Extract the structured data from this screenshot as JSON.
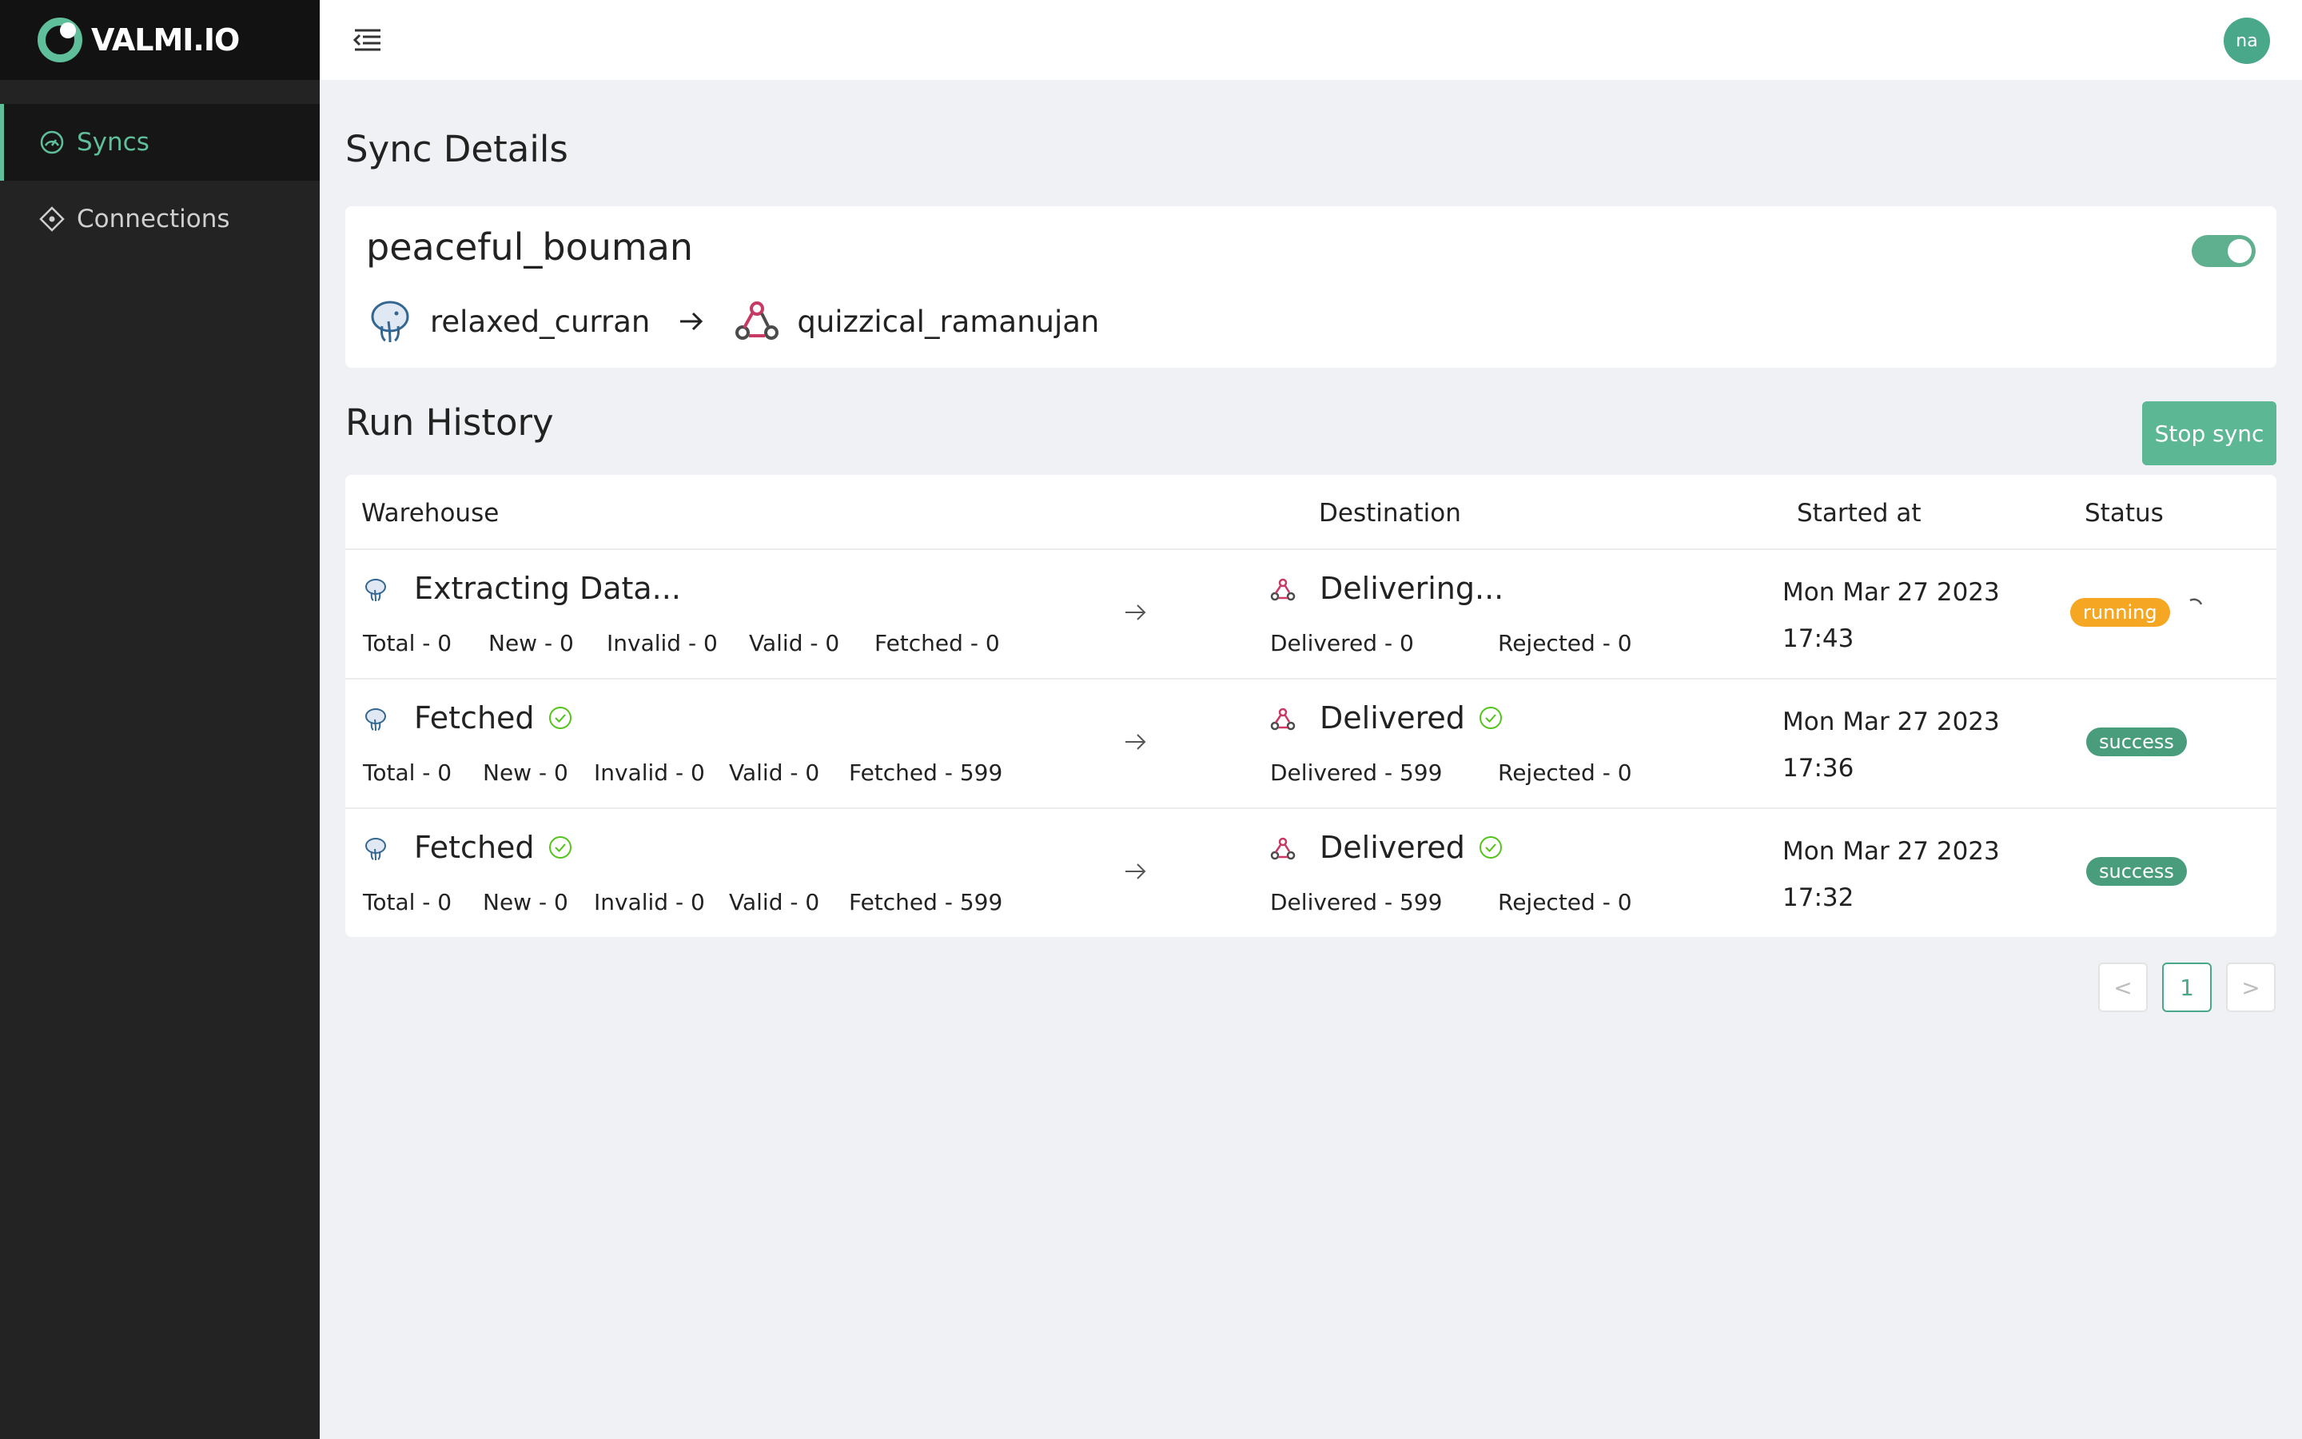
{
  "app": {
    "logo_text": "VALMI.IO",
    "brand_color": "#5fbf9a"
  },
  "sidebar": {
    "items": [
      {
        "label": "Syncs",
        "icon": "dashboard-icon",
        "active": true
      },
      {
        "label": "Connections",
        "icon": "diamond-icon",
        "active": false
      }
    ]
  },
  "header": {
    "avatar_initials": "na"
  },
  "page": {
    "title": "Sync Details"
  },
  "sync": {
    "name": "peaceful_bouman",
    "enabled": true,
    "source": {
      "name": "relaxed_curran",
      "icon": "postgres-icon"
    },
    "destination": {
      "name": "quizzical_ramanujan",
      "icon": "webhook-icon"
    }
  },
  "run_history": {
    "title": "Run History",
    "stop_label": "Stop sync",
    "columns": [
      "Warehouse",
      "Destination",
      "Started at",
      "Status"
    ],
    "rows": [
      {
        "warehouse_status": "Extracting Data...",
        "metrics": [
          "Total - 0",
          "New - 0",
          "Invalid - 0",
          "Valid - 0",
          "Fetched - 0"
        ],
        "destination_status": "Delivering...",
        "delivered": "Delivered - 0",
        "rejected": "Rejected - 0",
        "started_date": "Mon Mar 27 2023",
        "started_time": "17:43",
        "status": "running"
      },
      {
        "warehouse_status": "Fetched",
        "metrics": [
          "Total - 0",
          "New - 0",
          "Invalid - 0",
          "Valid - 0",
          "Fetched - 599"
        ],
        "destination_status": "Delivered",
        "delivered": "Delivered - 599",
        "rejected": "Rejected - 0",
        "started_date": "Mon Mar 27 2023",
        "started_time": "17:36",
        "status": "success"
      },
      {
        "warehouse_status": "Fetched",
        "metrics": [
          "Total - 0",
          "New - 0",
          "Invalid - 0",
          "Valid - 0",
          "Fetched - 599"
        ],
        "destination_status": "Delivered",
        "delivered": "Delivered - 599",
        "rejected": "Rejected - 0",
        "started_date": "Mon Mar 27 2023",
        "started_time": "17:32",
        "status": "success"
      }
    ]
  },
  "pagination": {
    "prev": "<",
    "current": "1",
    "next": ">"
  },
  "colors": {
    "running": "#f5a623",
    "success": "#4a9d7c",
    "check": "#52c41a"
  }
}
